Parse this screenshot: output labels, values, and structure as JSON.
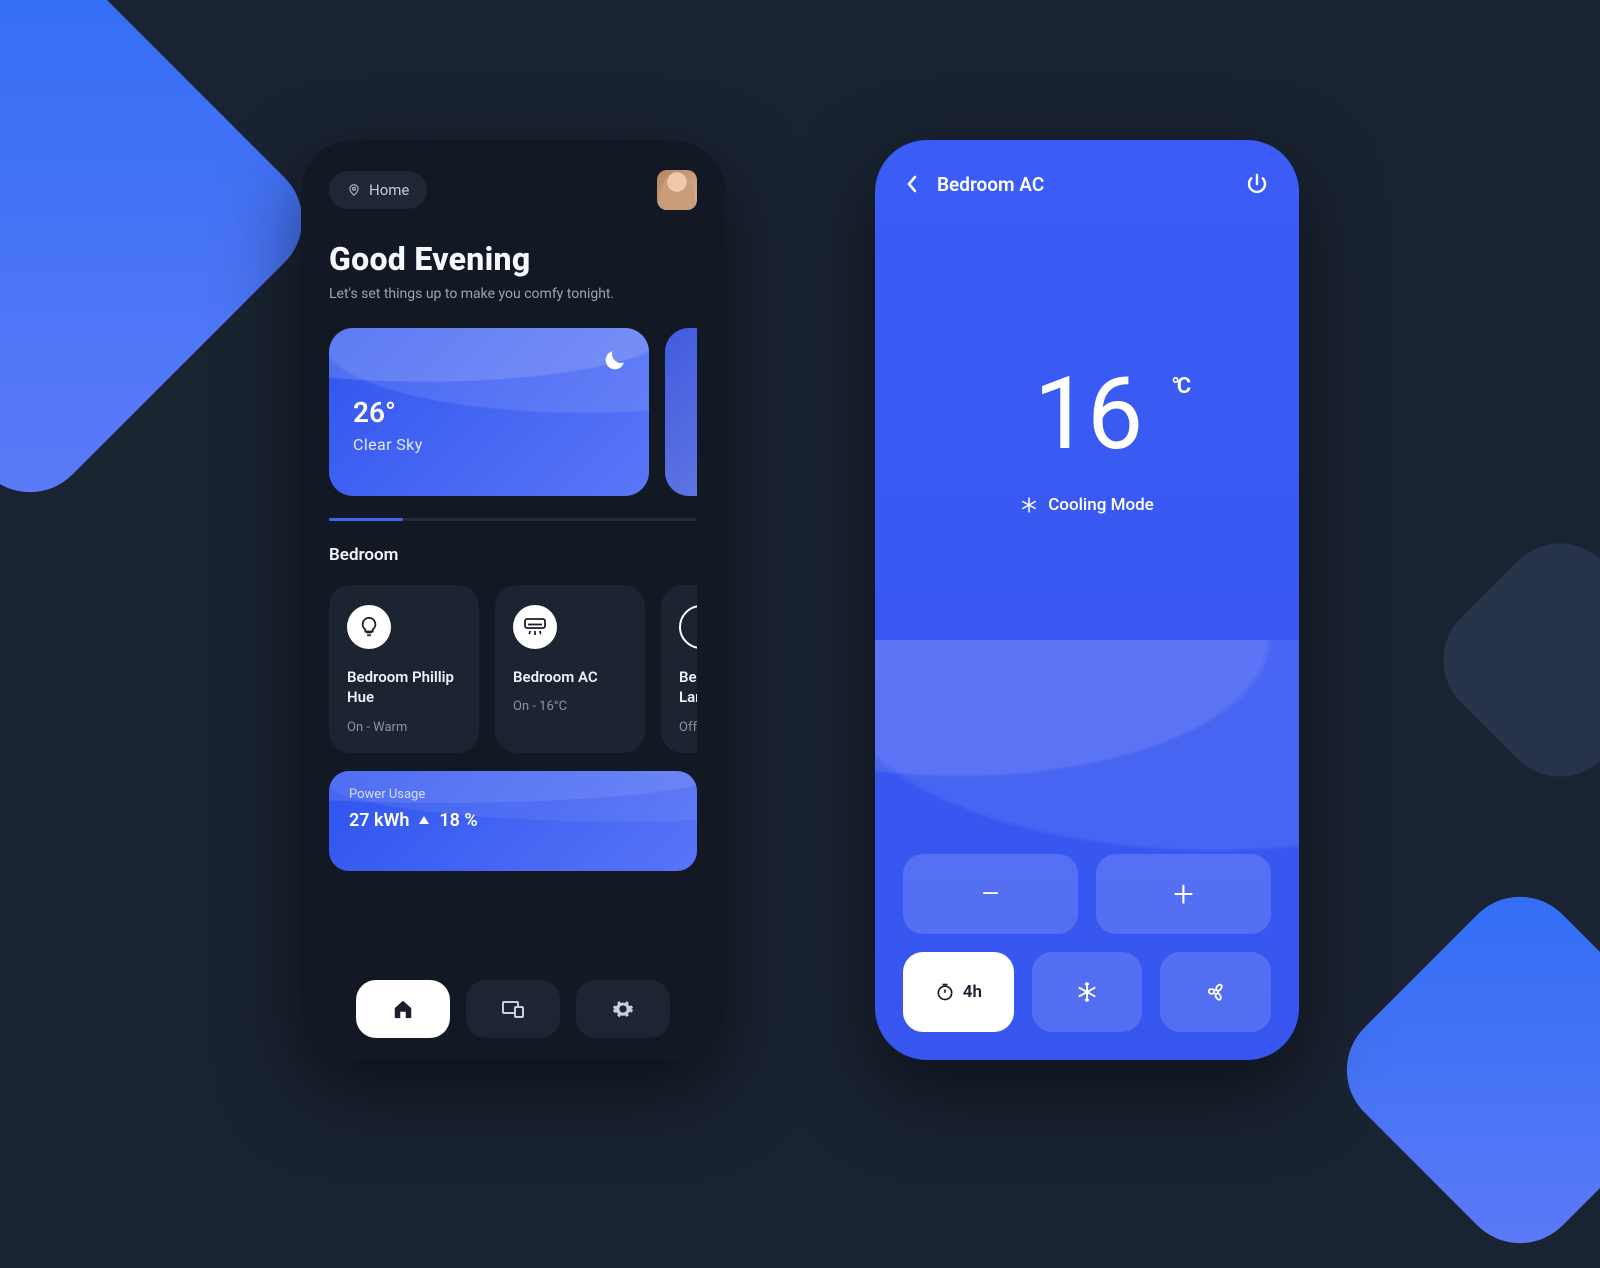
{
  "home": {
    "location_label": "Home",
    "greeting_title": "Good Evening",
    "greeting_sub": "Let's set things up to make you comfy tonight.",
    "weather": {
      "temp": "26°",
      "condition": "Clear Sky"
    },
    "section_title": "Bedroom",
    "devices": [
      {
        "name": "Bedroom Phillip Hue",
        "status": "On - Warm"
      },
      {
        "name": "Bedroom AC",
        "status": "On - 16°C"
      },
      {
        "name": "Bedroom Lamp",
        "status": "Off"
      }
    ],
    "power": {
      "label": "Power Usage",
      "value": "27 kWh",
      "delta": "18 %"
    }
  },
  "ac": {
    "title": "Bedroom AC",
    "temp": "16",
    "unit": "°C",
    "mode": "Cooling Mode",
    "timer": "4h"
  },
  "colors": {
    "accent": "#3b5cf6",
    "dark": "#131924"
  }
}
